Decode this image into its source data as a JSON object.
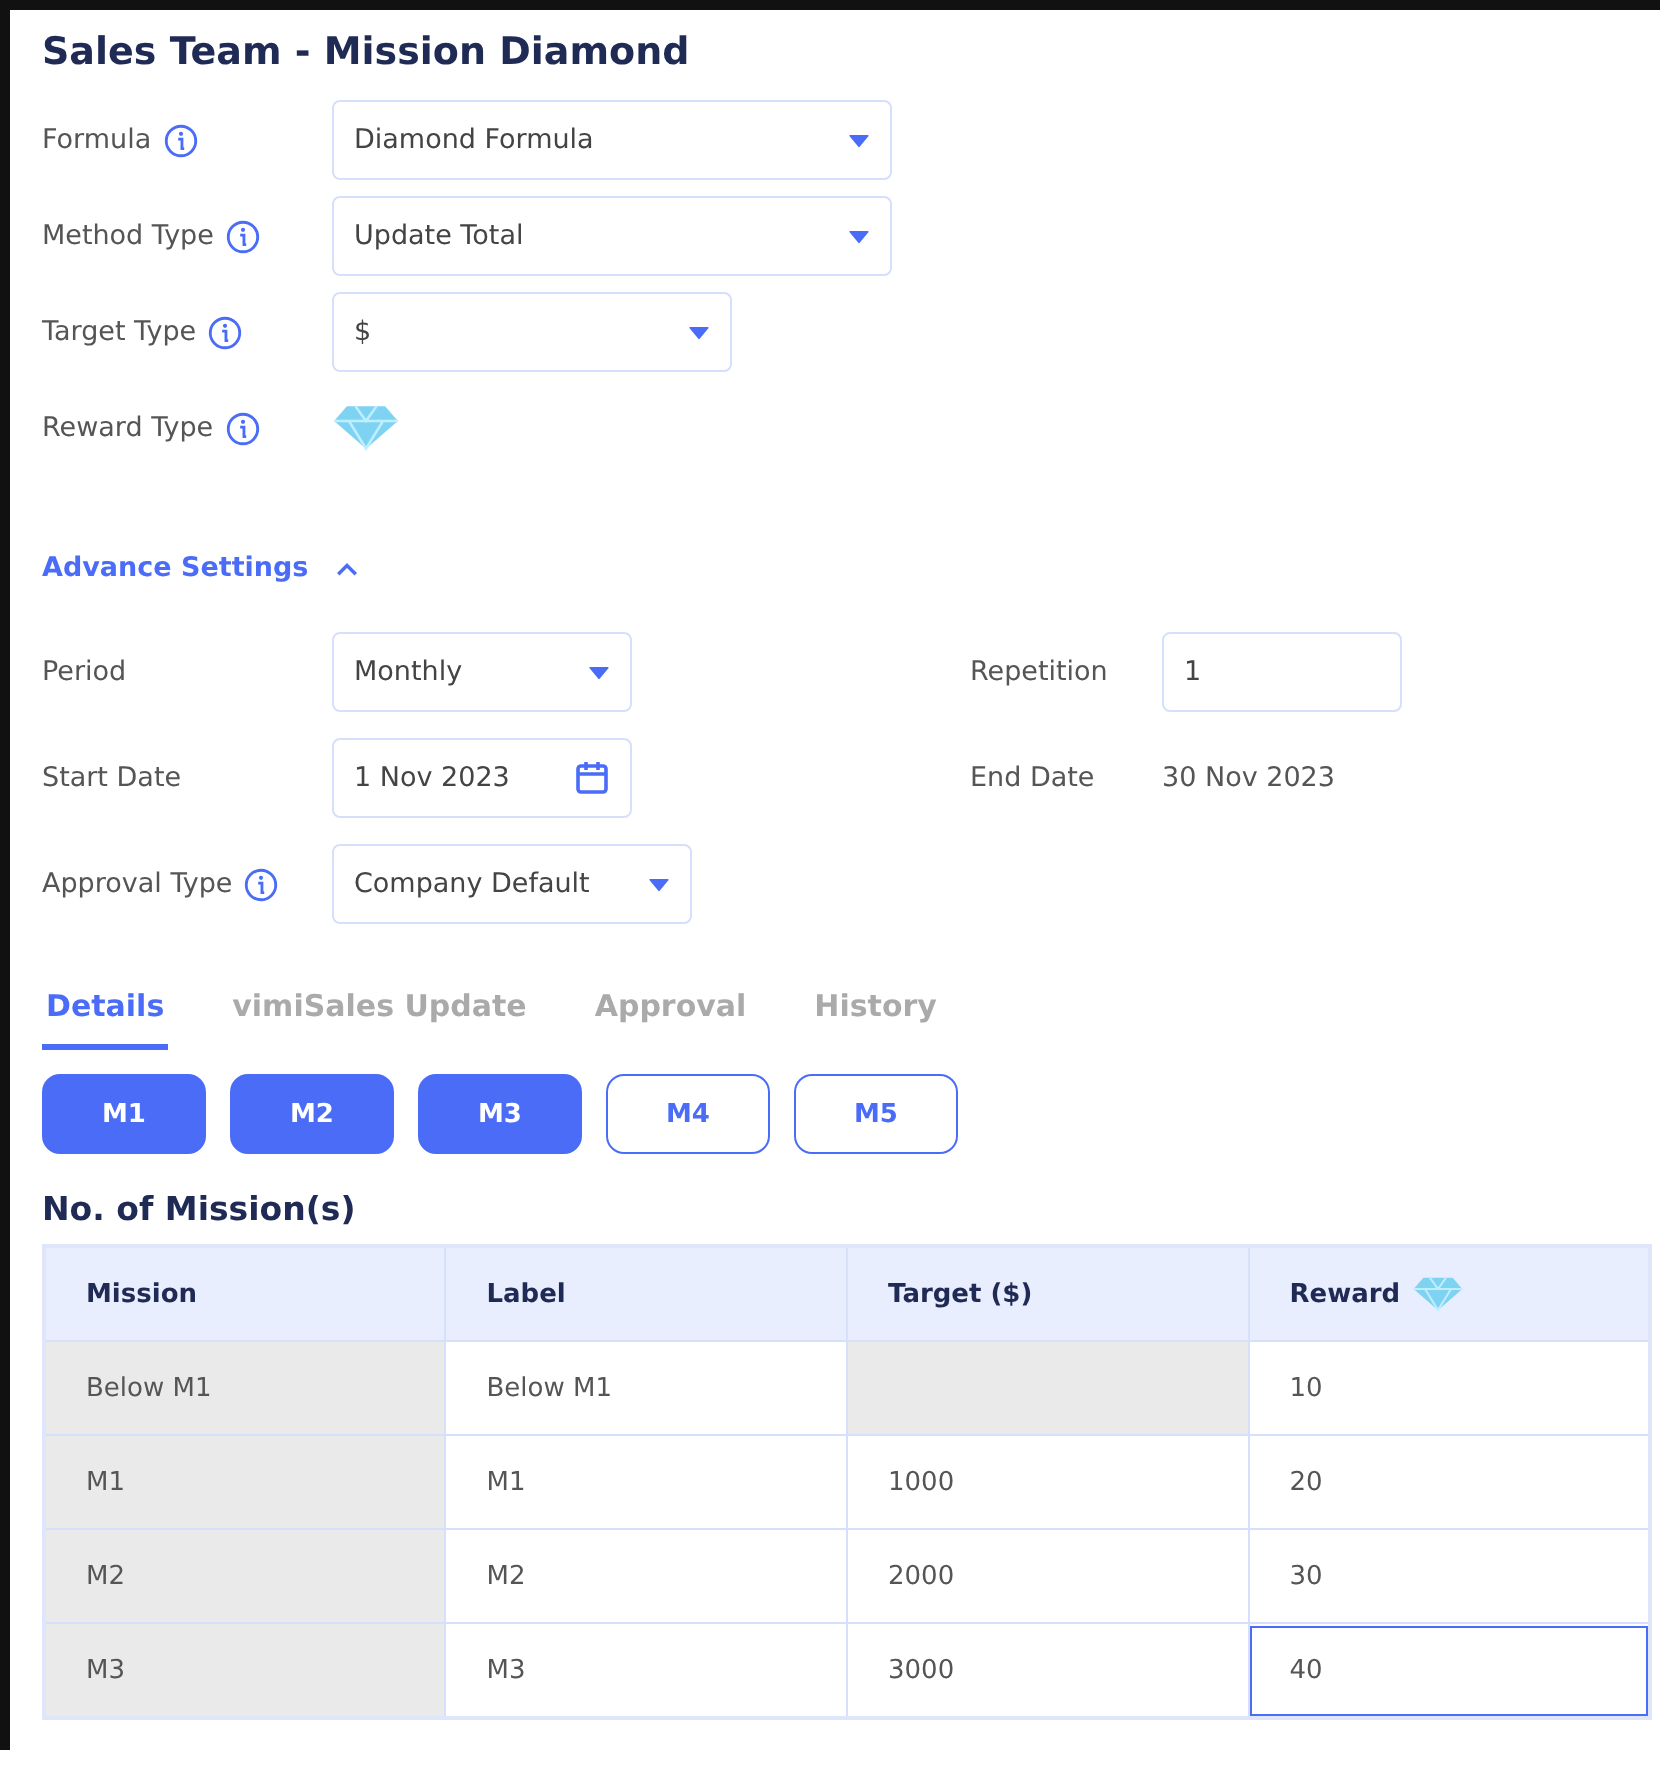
{
  "title": "Sales Team - Mission Diamond",
  "fields": [
    {
      "label": "Formula",
      "info": true,
      "kind": "select",
      "value": "Diamond Formula"
    },
    {
      "label": "Method Type",
      "info": true,
      "kind": "select",
      "value": "Update Total"
    },
    {
      "label": "Target Type",
      "info": true,
      "kind": "select-short",
      "value": "$"
    },
    {
      "label": "Reward Type",
      "info": true,
      "kind": "diamond"
    }
  ],
  "advance_settings": {
    "label": "Advance Settings",
    "expanded": true
  },
  "settings": [
    {
      "label": "Period",
      "info": false,
      "kind": "select",
      "value": "Monthly"
    },
    {
      "label": "Repetition",
      "info": false,
      "kind": "input",
      "value": "1"
    },
    {
      "label": "Start Date",
      "info": false,
      "kind": "date",
      "value": "1 Nov 2023"
    },
    {
      "label": "End Date",
      "info": false,
      "kind": "text",
      "value": "30 Nov 2023"
    },
    {
      "label": "Approval Type",
      "info": true,
      "kind": "select",
      "value": "Company Default"
    }
  ],
  "tabs": [
    {
      "label": "Details",
      "selected": true
    },
    {
      "label": "vimiSales Update",
      "selected": false
    },
    {
      "label": "Approval",
      "selected": false
    },
    {
      "label": "History",
      "selected": false
    }
  ],
  "missions": [
    {
      "label": "M1",
      "selected": true
    },
    {
      "label": "M2",
      "selected": true
    },
    {
      "label": "M3",
      "selected": true
    },
    {
      "label": "M4",
      "selected": false
    },
    {
      "label": "M5",
      "selected": false
    }
  ],
  "table": {
    "title": "No. of Mission(s)",
    "columns": [
      {
        "label": "Mission",
        "diamond": false
      },
      {
        "label": "Label",
        "diamond": false
      },
      {
        "label": "Target ($)",
        "diamond": false
      },
      {
        "label": "Reward",
        "diamond": true
      }
    ],
    "rows": [
      [
        {
          "text": "Below M1",
          "disabled": true
        },
        {
          "text": "Below M1",
          "disabled": false
        },
        {
          "disabled": true
        },
        {
          "text": "10",
          "disabled": false
        }
      ],
      [
        {
          "text": "M1",
          "disabled": true
        },
        {
          "text": "M1",
          "disabled": false
        },
        {
          "text": "1000",
          "disabled": false
        },
        {
          "text": "20",
          "disabled": false
        }
      ],
      [
        {
          "text": "M2",
          "disabled": true
        },
        {
          "text": "M2",
          "disabled": false
        },
        {
          "text": "2000",
          "disabled": false
        },
        {
          "text": "30",
          "disabled": false
        }
      ],
      [
        {
          "text": "M3",
          "disabled": true
        },
        {
          "text": "M3",
          "disabled": false
        },
        {
          "text": "3000",
          "disabled": false
        },
        {
          "text": "40",
          "disabled": false,
          "focused": true
        }
      ]
    ]
  }
}
